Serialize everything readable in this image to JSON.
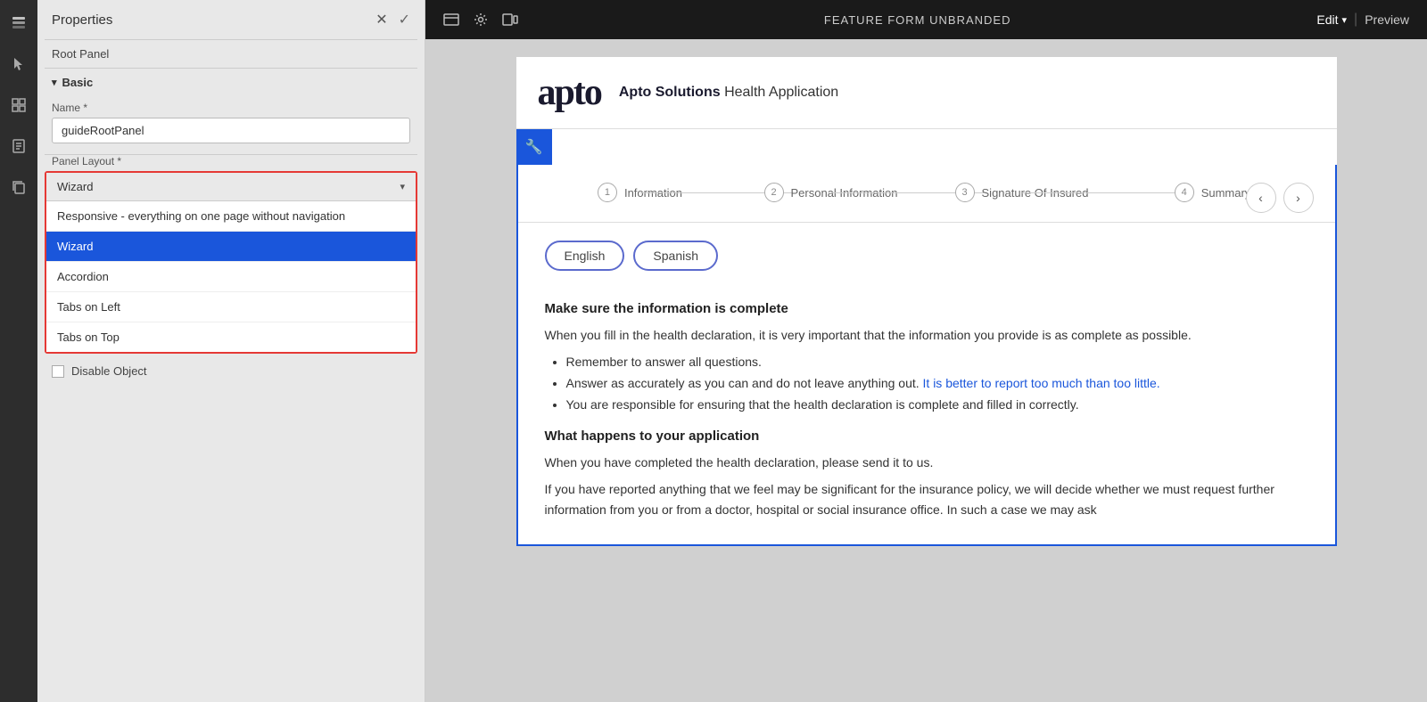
{
  "leftSidebar": {
    "icons": [
      {
        "name": "layers-icon",
        "symbol": "⬡",
        "active": true
      },
      {
        "name": "cursor-icon",
        "symbol": "↖"
      },
      {
        "name": "grid-icon",
        "symbol": "⊞"
      },
      {
        "name": "list-icon",
        "symbol": "≡"
      },
      {
        "name": "copy-icon",
        "symbol": "⧉"
      }
    ]
  },
  "propertiesPanel": {
    "title": "Properties",
    "rootLabel": "Root Panel",
    "basic": {
      "sectionLabel": "Basic",
      "nameLabel": "Name *",
      "nameValue": "guideRootPanel"
    },
    "panelLayout": {
      "label": "Panel Layout *",
      "selected": "Wizard",
      "options": [
        {
          "value": "Responsive - everything on one page without navigation",
          "selected": false
        },
        {
          "value": "Wizard",
          "selected": true
        },
        {
          "value": "Accordion",
          "selected": false
        },
        {
          "value": "Tabs on Left",
          "selected": false
        },
        {
          "value": "Tabs on Top",
          "selected": false
        }
      ]
    },
    "disableObject": {
      "label": "Disable Object",
      "checked": false
    }
  },
  "topNav": {
    "title": "FEATURE FORM UNBRANDED",
    "editLabel": "Edit",
    "previewLabel": "Preview"
  },
  "formHeader": {
    "logoText": "apto",
    "companyName": "Apto Solutions",
    "applicationTitle": "Health Application"
  },
  "wizardSteps": [
    {
      "number": "1",
      "label": "Information"
    },
    {
      "number": "2",
      "label": "Personal Information"
    },
    {
      "number": "3",
      "label": "Signature Of Insured"
    },
    {
      "number": "4",
      "label": "Summary"
    }
  ],
  "languageButtons": [
    {
      "label": "English"
    },
    {
      "label": "Spanish"
    }
  ],
  "formContent": {
    "section1": {
      "title": "Make sure the information is complete",
      "paragraph": "When you fill in the health declaration, it is very important that the information you provide is as complete as possible.",
      "bullets": [
        "Remember to answer all questions.",
        "Answer as accurately as you can and do not leave anything out. It is better to report too much than too little.",
        "You are responsible for ensuring that the health declaration is complete and filled in correctly."
      ]
    },
    "section2": {
      "title": "What happens to your application",
      "paragraph1": "When you have completed the health declaration, please send it to us.",
      "paragraph2": "If you have reported anything that we feel may be significant for the insurance policy, we will decide whether we must request further information from you or from a doctor, hospital or social insurance office. In such a case we may ask"
    }
  }
}
